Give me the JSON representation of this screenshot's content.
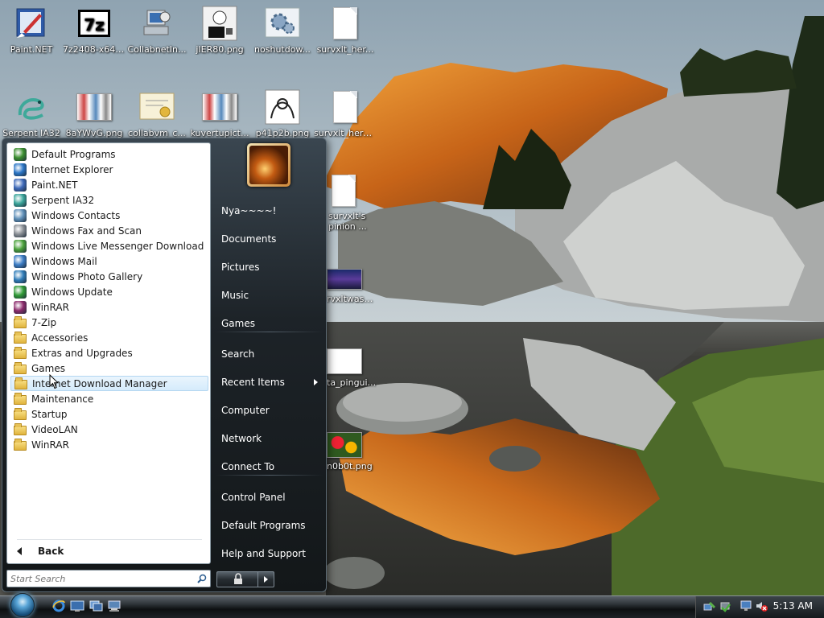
{
  "desktop": {
    "icons_row1": [
      {
        "label": "Paint.NET",
        "icon": "paintnet-icon"
      },
      {
        "label": "7z2408-x64....",
        "icon": "7zip-installer-icon"
      },
      {
        "label": "CollabnetIn...",
        "icon": "installer-computer-icon"
      },
      {
        "label": "jIER80.png",
        "icon": "image-file-icon"
      },
      {
        "label": "noshutdow...",
        "icon": "settings-gears-icon"
      },
      {
        "label": "survxlt_her...",
        "icon": "text-file-icon"
      }
    ],
    "icons_row2": [
      {
        "label": "Serpent IA32",
        "icon": "serpent-icon"
      },
      {
        "label": "8aYWvG.png",
        "icon": "image-file-icon"
      },
      {
        "label": "collabvm_c...",
        "icon": "certificate-icon"
      },
      {
        "label": "kuvertupict...",
        "icon": "image-file-icon"
      },
      {
        "label": "p41p2b.png",
        "icon": "image-file-icon"
      },
      {
        "label": "survxlt_here...",
        "icon": "text-file-icon"
      }
    ],
    "icons_col": [
      {
        "label": "survxlt's pinion ...",
        "icon": "text-file-icon"
      },
      {
        "label": "rvxltwash...",
        "icon": "image-file-icon"
      },
      {
        "label": "ta_pingui...",
        "icon": "image-file-icon"
      },
      {
        "label": "n0b0t.png",
        "icon": "image-file-icon"
      }
    ]
  },
  "start_menu": {
    "programs": [
      {
        "label": "Default Programs",
        "icon": "default-programs-icon",
        "color": "#3a8e2e"
      },
      {
        "label": "Internet Explorer",
        "icon": "internet-explorer-icon",
        "color": "#2a75c6"
      },
      {
        "label": "Paint.NET",
        "icon": "paintnet-icon",
        "color": "#3c68b8"
      },
      {
        "label": "Serpent IA32",
        "icon": "serpent-icon",
        "color": "#3aa59a"
      },
      {
        "label": "Windows Contacts",
        "icon": "contacts-icon",
        "color": "#5e8fb8"
      },
      {
        "label": "Windows Fax and Scan",
        "icon": "fax-icon",
        "color": "#8a8f95"
      },
      {
        "label": "Windows Live Messenger Download",
        "icon": "messenger-icon",
        "color": "#4aa13a"
      },
      {
        "label": "Windows Mail",
        "icon": "mail-icon",
        "color": "#3b7cc4"
      },
      {
        "label": "Windows Photo Gallery",
        "icon": "photo-gallery-icon",
        "color": "#2f7cb8"
      },
      {
        "label": "Windows Update",
        "icon": "windows-update-icon",
        "color": "#2f9a35"
      },
      {
        "label": "WinRAR",
        "icon": "winrar-icon",
        "color": "#8b2a6b"
      },
      {
        "label": "7-Zip",
        "icon": "folder-icon",
        "color": ""
      },
      {
        "label": "Accessories",
        "icon": "folder-icon",
        "color": ""
      },
      {
        "label": "Extras and Upgrades",
        "icon": "folder-icon",
        "color": ""
      },
      {
        "label": "Games",
        "icon": "folder-icon",
        "color": ""
      },
      {
        "label": "Internet Download Manager",
        "icon": "folder-icon",
        "color": ""
      },
      {
        "label": "Maintenance",
        "icon": "folder-icon",
        "color": ""
      },
      {
        "label": "Startup",
        "icon": "folder-icon",
        "color": ""
      },
      {
        "label": "VideoLAN",
        "icon": "folder-icon",
        "color": ""
      },
      {
        "label": "WinRAR",
        "icon": "folder-icon",
        "color": ""
      }
    ],
    "highlighted_index": 15,
    "back_label": "Back",
    "search_placeholder": "Start Search",
    "right_items": [
      {
        "label": "Nya~~~~!",
        "submenu": false
      },
      {
        "label": "Documents",
        "submenu": false
      },
      {
        "label": "Pictures",
        "submenu": false
      },
      {
        "label": "Music",
        "submenu": false
      },
      {
        "label": "Games",
        "submenu": false
      },
      {
        "label": "Search",
        "submenu": false
      },
      {
        "label": "Recent Items",
        "submenu": true
      },
      {
        "label": "Computer",
        "submenu": false
      },
      {
        "label": "Network",
        "submenu": false
      },
      {
        "label": "Connect To",
        "submenu": false
      },
      {
        "label": "Control Panel",
        "submenu": false
      },
      {
        "label": "Default Programs",
        "submenu": false
      },
      {
        "label": "Help and Support",
        "submenu": false
      }
    ]
  },
  "taskbar": {
    "quick_launch": [
      "internet-explorer-icon",
      "show-desktop-icon",
      "switch-windows-icon",
      "network-icon"
    ],
    "tray_icons": [
      "network-status-icon",
      "safely-remove-icon",
      "display-icon",
      "volume-muted-icon"
    ],
    "clock": "5:13 AM"
  }
}
